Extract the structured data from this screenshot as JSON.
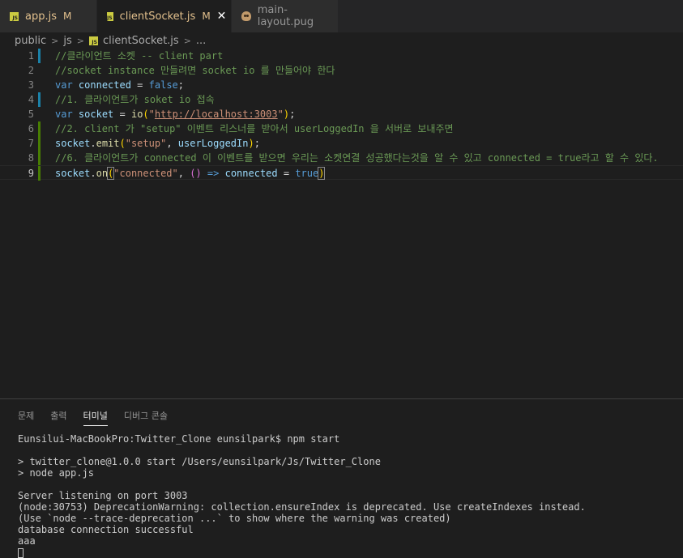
{
  "tabs": [
    {
      "label": "app.js",
      "modified": "M",
      "active": false
    },
    {
      "label": "clientSocket.js",
      "modified": "M",
      "active": true,
      "close": "✕"
    },
    {
      "label": "main-layout.pug",
      "active": false
    }
  ],
  "breadcrumb": [
    "public",
    "js",
    "clientSocket.js",
    "..."
  ],
  "editor": {
    "lines": [
      {
        "n": "1",
        "gutter": "mod",
        "tokens": [
          [
            "cm",
            "//클라이언트 소켓 -- client part"
          ]
        ]
      },
      {
        "n": "2",
        "gutter": "",
        "tokens": [
          [
            "cm",
            "//socket instance 만들려면 socket io 를 만들어야 한다"
          ]
        ]
      },
      {
        "n": "3",
        "gutter": "",
        "tokens": [
          [
            "kw",
            "var"
          ],
          [
            "op",
            " "
          ],
          [
            "var",
            "connected"
          ],
          [
            "op",
            " = "
          ],
          [
            "kw",
            "false"
          ],
          [
            "op",
            ";"
          ]
        ]
      },
      {
        "n": "4",
        "gutter": "mod",
        "tokens": [
          [
            "cm",
            "//1. 클라이언트가 soket io 접속"
          ]
        ]
      },
      {
        "n": "5",
        "gutter": "",
        "tokens": [
          [
            "kw",
            "var"
          ],
          [
            "op",
            " "
          ],
          [
            "var",
            "socket"
          ],
          [
            "op",
            " = "
          ],
          [
            "fn",
            "io"
          ],
          [
            "br1",
            "("
          ],
          [
            "str",
            "\""
          ],
          [
            "url",
            "http://localhost:3003"
          ],
          [
            "str",
            "\""
          ],
          [
            "br1",
            ")"
          ],
          [
            "op",
            ";"
          ]
        ]
      },
      {
        "n": "6",
        "gutter": "add",
        "tokens": [
          [
            "cm",
            "//2. client 가 \"setup\" 이벤트 리스너를 받아서 userLoggedIn 을 서버로 보내주면"
          ]
        ]
      },
      {
        "n": "7",
        "gutter": "add",
        "tokens": [
          [
            "var",
            "socket"
          ],
          [
            "op",
            "."
          ],
          [
            "fn",
            "emit"
          ],
          [
            "br1",
            "("
          ],
          [
            "str",
            "\"setup\""
          ],
          [
            "op",
            ", "
          ],
          [
            "var",
            "userLoggedIn"
          ],
          [
            "br1",
            ")"
          ],
          [
            "op",
            ";"
          ]
        ]
      },
      {
        "n": "8",
        "gutter": "add",
        "tokens": [
          [
            "cm",
            "//6. 클라이언트가 connected 이 이벤트를 받으면 우리는 소켓연결 성공했다는것을 알 수 있고 connected = true라고 할 수 있다."
          ]
        ]
      },
      {
        "n": "9",
        "gutter": "add",
        "current": true,
        "tokens": [
          [
            "var",
            "socket"
          ],
          [
            "op",
            "."
          ],
          [
            "fn",
            "on"
          ],
          [
            "br1m",
            "("
          ],
          [
            "str",
            "\"connected\""
          ],
          [
            "op",
            ", "
          ],
          [
            "br2",
            "()"
          ],
          [
            "op",
            " "
          ],
          [
            "kw",
            "=>"
          ],
          [
            "op",
            " "
          ],
          [
            "var",
            "connected"
          ],
          [
            "op",
            " = "
          ],
          [
            "kw",
            "true"
          ],
          [
            "br1m",
            ")"
          ]
        ]
      }
    ]
  },
  "panel": {
    "tabs": [
      {
        "label": "문제",
        "active": false
      },
      {
        "label": "출력",
        "active": false
      },
      {
        "label": "터미널",
        "active": true
      },
      {
        "label": "디버그 콘솔",
        "active": false
      }
    ],
    "terminal_lines": [
      "Eunsilui-MacBookPro:Twitter_Clone eunsilpark$ npm start",
      "",
      "> twitter_clone@1.0.0 start /Users/eunsilpark/Js/Twitter_Clone",
      "> node app.js",
      "",
      "Server listening on port 3003",
      "(node:30753) DeprecationWarning: collection.ensureIndex is deprecated. Use createIndexes instead.",
      "(Use `node --trace-deprecation ...` to show where the warning was created)",
      "database connection successful",
      "aaa"
    ]
  }
}
